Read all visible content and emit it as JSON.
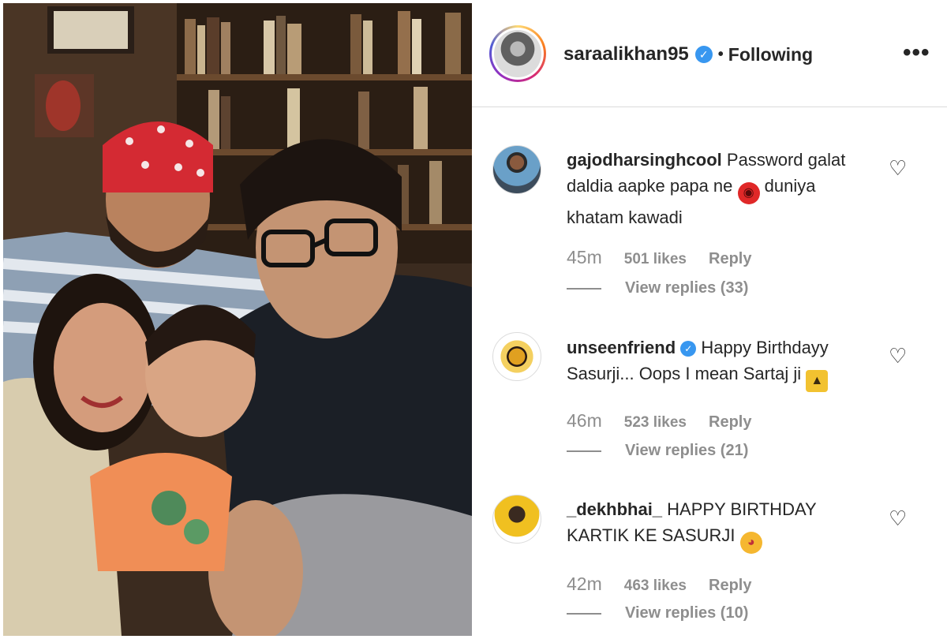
{
  "header": {
    "username": "saraalikhan95",
    "separator": "•",
    "follow_state": "Following",
    "verified_glyph": "✓",
    "more_icon": "more-horizontal-icon"
  },
  "comments": [
    {
      "username": "gajodharsinghcool",
      "verified": false,
      "text": "Password galat daldia aapke papa ne",
      "emoji": "angry-face",
      "text_after": "duniya khatam kawadi",
      "time": "45m",
      "likes": "501 likes",
      "reply": "Reply",
      "view_replies": "View replies (33)"
    },
    {
      "username": "unseenfriend",
      "verified": true,
      "text": "Happy Birthdayy Sasurji... Oops I mean Sartaj ji",
      "emoji": "party-popper",
      "text_after": "",
      "time": "46m",
      "likes": "523 likes",
      "reply": "Reply",
      "view_replies": "View replies (21)"
    },
    {
      "username": "_dekhbhai_",
      "verified": false,
      "text": "HAPPY BIRTHDAY KARTIK KE SASURJI",
      "emoji": "tongue-out-face",
      "text_after": "",
      "time": "42m",
      "likes": "463 likes",
      "reply": "Reply",
      "view_replies": "View replies (10)"
    }
  ],
  "colors": {
    "verified": "#3897f0",
    "meta_gray": "#8e8e8e",
    "text": "#262626"
  }
}
